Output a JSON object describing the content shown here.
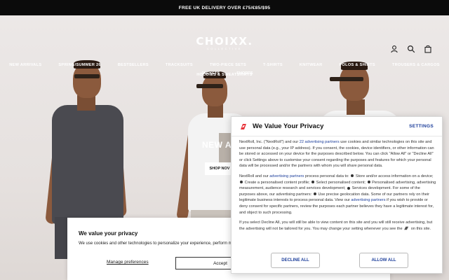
{
  "promo": {
    "text": "FREE UK DELIVERY OVER £75/€85/$95"
  },
  "header": {
    "brand": "CHOIXX.",
    "brand_sub": "COLLECTIVE",
    "icons": [
      "account-icon",
      "search-icon",
      "bag-icon"
    ]
  },
  "nav": {
    "row1": [
      "NEW ARRIVALS",
      "SPRING/SUMMER 26",
      "BESTSELLERS",
      "TRACKSUITS",
      "TWO-PIECE SETS",
      "T-SHIRTS",
      "KNITWEAR",
      "POLOS & SHIRTS",
      "TROUSERS & CARGOS",
      "HOODIES & SWEATSHIRTS"
    ],
    "row2": [
      "JACKETS",
      "SHORTS"
    ]
  },
  "hero": {
    "heading": "NEW ARR",
    "cta": "SHOP NOV"
  },
  "cookie_bar": {
    "title": "We value your privacy",
    "text": "We use cookies and other technologies to personalize your experience, perform marketing",
    "manage": "Manage preferences",
    "accept": "Accept"
  },
  "privacy_dialog": {
    "title": "We Value Your Privacy",
    "settings": "SETTINGS",
    "p1_a": "NextRoll, Inc. (\"NextRoll\") and our ",
    "p1_link": "22 advertising partners",
    "p1_b": " use cookies and similar technologies on this site and use personal data (e.g., your IP address). If you consent, the cookies, device identifiers, or other information can be stored or accessed on your device for the purposes described below. You can click \"Allow All\" or \"Decline All\" or click Settings above to customise your consent regarding the purposes and features for which your personal data will be processed and/or the partners with whom you will share personal data.",
    "p2_a": "NextRoll and our ",
    "p2_link1": "advertising partners",
    "p2_b": " process personal data to: ",
    "p2_items": [
      "Store and/or access information on a device;",
      "Create a personalised content profile;",
      "Select personalised content;",
      "Personalised advertising, advertising measurement, audience research and services development;",
      "Services development. For some of the purposes above, our advertising partners:",
      "Use precise geolocation data."
    ],
    "p2_c": " Some of our partners rely on their legitimate business interests to process personal data. View our ",
    "p2_link2": "advertising partners",
    "p2_d": " if you wish to provide or deny consent for specific partners, review the purposes each partner believes they have a legitimate interest for, and object to such processing.",
    "p3_a": "If you select Decline All, you will still be able to view content on this site and you will still receive advertising, but the advertising will not be tailored for you. You may change your setting whenever you see the ",
    "p3_b": " on this site.",
    "decline": "DECLINE ALL",
    "allow": "ALLOW ALL"
  }
}
